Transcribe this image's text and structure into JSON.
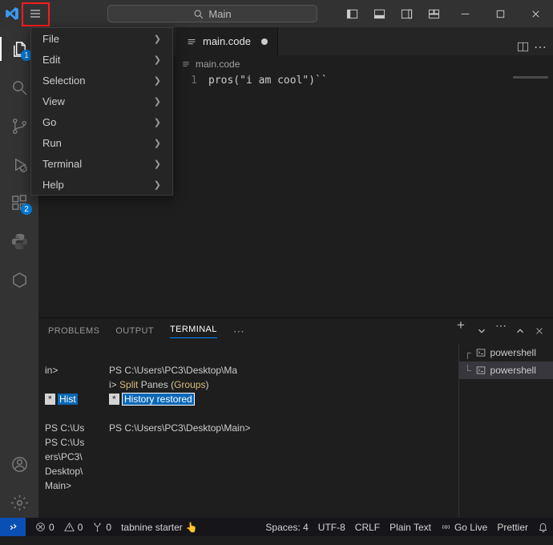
{
  "search_label": "Main",
  "menu": [
    "File",
    "Edit",
    "Selection",
    "View",
    "Go",
    "Run",
    "Terminal",
    "Help"
  ],
  "activity": {
    "badges": {
      "explorer": "1",
      "extensions": "2"
    }
  },
  "tab": {
    "filename": "main.code"
  },
  "breadcrumb": "main.code",
  "code": {
    "line_no": "1",
    "line": "pros(\"i am cool\")``"
  },
  "panel": {
    "tabs": [
      "PROBLEMS",
      "OUTPUT",
      "TERMINAL"
    ],
    "left": {
      "l1": "in>",
      "hist_star": "*",
      "hist_text": "Hist",
      "wrap": "PS C:\\Us\nPS C:\\Us\ners\\PC3\\\nDesktop\\\nMain>"
    },
    "mid": {
      "l1": "PS C:\\Users\\PC3\\Desktop\\Ma",
      "l2a": "i>",
      "l2b": "Split",
      "l2c": "Panes",
      "l2d": "Groups",
      "hist_star": "*",
      "hist_text": "History restored",
      "prompt": "PS C:\\Users\\PC3\\Desktop\\Main>"
    },
    "side": {
      "items": [
        "powershell",
        "powershell"
      ]
    }
  },
  "status": {
    "errors": "0",
    "warnings": "0",
    "ports": "0",
    "tabnine": "tabnine starter",
    "spaces": "Spaces: 4",
    "encoding": "UTF-8",
    "eol": "CRLF",
    "lang": "Plain Text",
    "golive": "Go Live",
    "prettier": "Prettier"
  }
}
